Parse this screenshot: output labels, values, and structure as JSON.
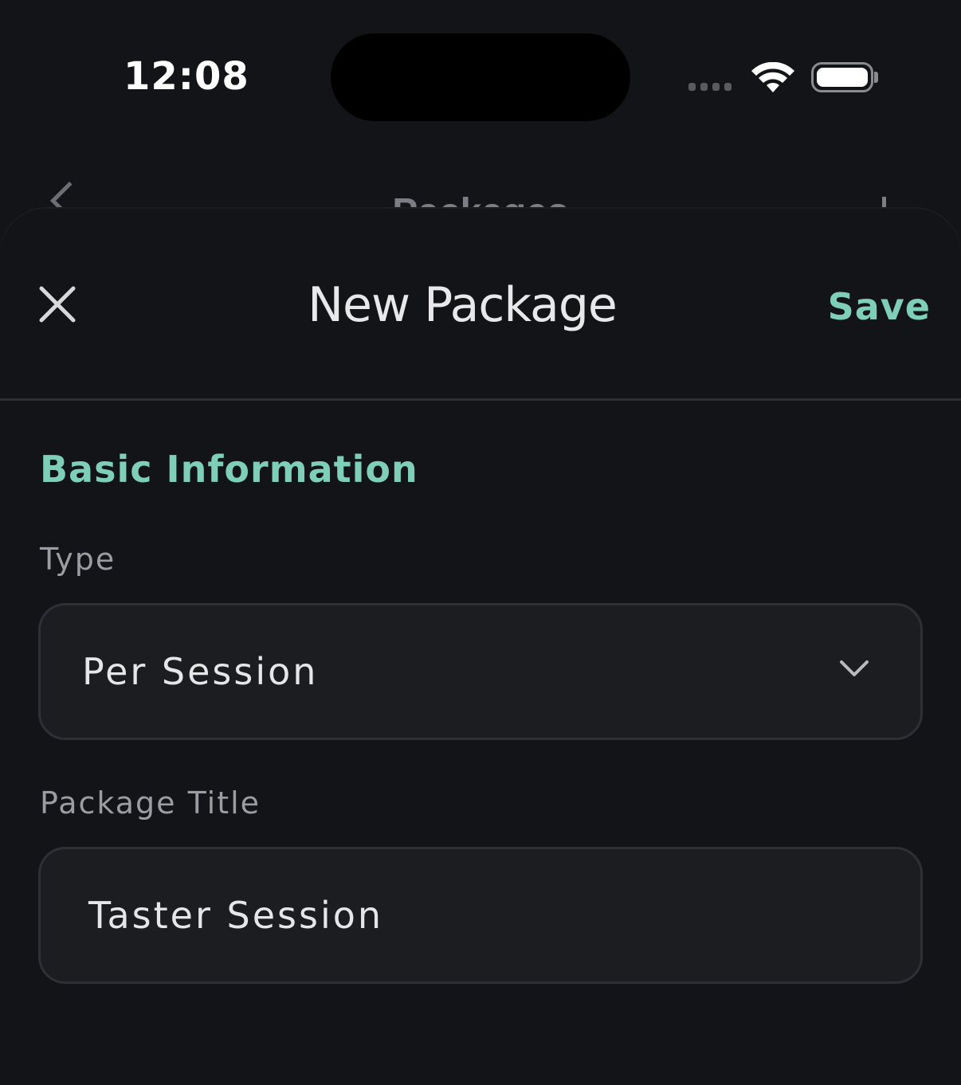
{
  "status_bar": {
    "time": "12:08",
    "icons": [
      "signal-icon",
      "wifi-icon",
      "battery-icon"
    ]
  },
  "background_nav": {
    "title": "Packages"
  },
  "sheet": {
    "title": "New Package",
    "close_icon": "close-icon",
    "save_label": "Save",
    "accent_color": "#7fcfb8"
  },
  "form": {
    "section_title": "Basic Information",
    "type": {
      "label": "Type",
      "value": "Per Session",
      "icon": "chevron-down-icon"
    },
    "package_title": {
      "label": "Package Title",
      "value": "Taster Session"
    }
  }
}
